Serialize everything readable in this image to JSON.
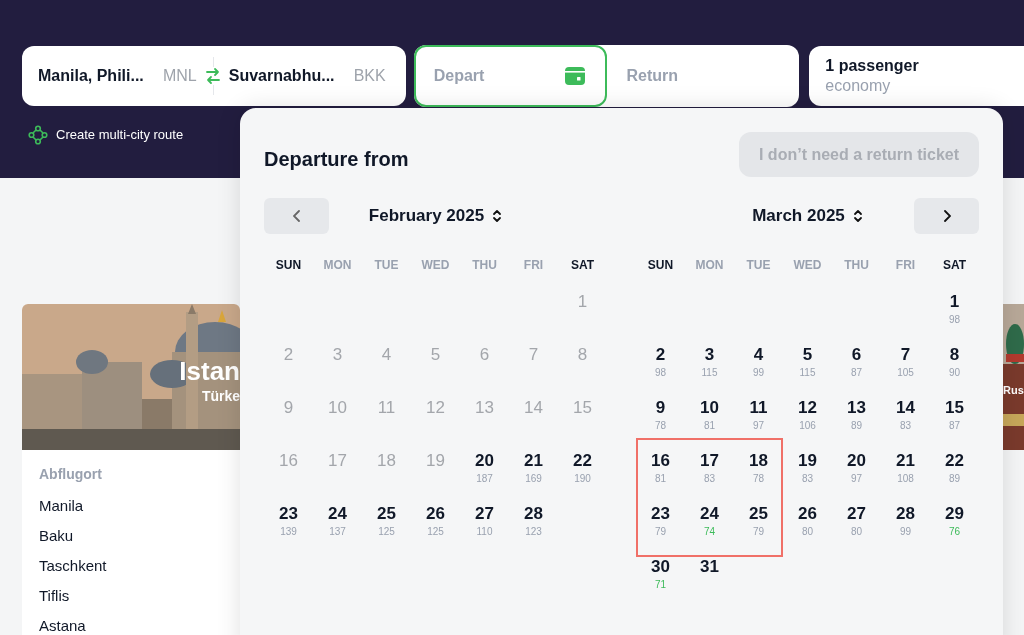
{
  "search": {
    "origin": {
      "city": "Manila, Phili...",
      "code": "MNL"
    },
    "destination": {
      "city": "Suvarnabhu...",
      "code": "BKK"
    },
    "dates": [
      {
        "placeholder": "Depart",
        "selected": true
      },
      {
        "placeholder": "Return",
        "selected": false
      }
    ],
    "passengers": {
      "count": "1 passenger",
      "cabin": "economy"
    },
    "multi_city_link": "Create multi-city route"
  },
  "destination_cards": [
    {
      "title": "Istan",
      "subtitle": "Türke",
      "list_heading": "Abflugort",
      "departures": [
        "Manila",
        "Baku",
        "Taschkent",
        "Tiflis",
        "Astana"
      ]
    },
    {
      "title": "Rus"
    }
  ],
  "date_picker": {
    "title": "Departure from",
    "no_return_button": "I don’t need a return ticket",
    "months": [
      {
        "name": "February 2025",
        "weekdays": [
          "SUN",
          "MON",
          "TUE",
          "WED",
          "THU",
          "FRI",
          "SAT"
        ],
        "weeks": [
          [
            {
              "kind": "blank"
            },
            {
              "kind": "blank"
            },
            {
              "kind": "blank"
            },
            {
              "kind": "blank"
            },
            {
              "kind": "blank"
            },
            {
              "kind": "blank"
            },
            {
              "kind": "day",
              "day": "1",
              "disabled": true
            }
          ],
          [
            {
              "kind": "day",
              "day": "2",
              "disabled": true
            },
            {
              "kind": "day",
              "day": "3",
              "disabled": true
            },
            {
              "kind": "day",
              "day": "4",
              "disabled": true
            },
            {
              "kind": "day",
              "day": "5",
              "disabled": true
            },
            {
              "kind": "day",
              "day": "6",
              "disabled": true
            },
            {
              "kind": "day",
              "day": "7",
              "disabled": true
            },
            {
              "kind": "day",
              "day": "8",
              "disabled": true
            }
          ],
          [
            {
              "kind": "day",
              "day": "9",
              "disabled": true
            },
            {
              "kind": "day",
              "day": "10",
              "disabled": true
            },
            {
              "kind": "day",
              "day": "11",
              "disabled": true
            },
            {
              "kind": "day",
              "day": "12",
              "disabled": true
            },
            {
              "kind": "day",
              "day": "13",
              "disabled": true
            },
            {
              "kind": "day",
              "day": "14",
              "disabled": true
            },
            {
              "kind": "day",
              "day": "15",
              "disabled": true
            }
          ],
          [
            {
              "kind": "day",
              "day": "16",
              "disabled": true
            },
            {
              "kind": "day",
              "day": "17",
              "disabled": true
            },
            {
              "kind": "day",
              "day": "18",
              "disabled": true
            },
            {
              "kind": "day",
              "day": "19",
              "disabled": true
            },
            {
              "kind": "day",
              "day": "20",
              "price": "187"
            },
            {
              "kind": "day",
              "day": "21",
              "price": "169"
            },
            {
              "kind": "day",
              "day": "22",
              "price": "190"
            }
          ],
          [
            {
              "kind": "day",
              "day": "23",
              "price": "139"
            },
            {
              "kind": "day",
              "day": "24",
              "price": "137"
            },
            {
              "kind": "day",
              "day": "25",
              "price": "125"
            },
            {
              "kind": "day",
              "day": "26",
              "price": "125"
            },
            {
              "kind": "day",
              "day": "27",
              "price": "110"
            },
            {
              "kind": "day",
              "day": "28",
              "price": "123"
            },
            {
              "kind": "blank"
            }
          ]
        ]
      },
      {
        "name": "March 2025",
        "weekdays": [
          "SUN",
          "MON",
          "TUE",
          "WED",
          "THU",
          "FRI",
          "SAT"
        ],
        "weeks": [
          [
            {
              "kind": "blank"
            },
            {
              "kind": "blank"
            },
            {
              "kind": "blank"
            },
            {
              "kind": "blank"
            },
            {
              "kind": "blank"
            },
            {
              "kind": "blank"
            },
            {
              "kind": "day",
              "day": "1",
              "price": "98"
            }
          ],
          [
            {
              "kind": "day",
              "day": "2",
              "price": "98"
            },
            {
              "kind": "day",
              "day": "3",
              "price": "115"
            },
            {
              "kind": "day",
              "day": "4",
              "price": "99"
            },
            {
              "kind": "day",
              "day": "5",
              "price": "115"
            },
            {
              "kind": "day",
              "day": "6",
              "price": "87"
            },
            {
              "kind": "day",
              "day": "7",
              "price": "105"
            },
            {
              "kind": "day",
              "day": "8",
              "price": "90"
            }
          ],
          [
            {
              "kind": "day",
              "day": "9",
              "price": "78"
            },
            {
              "kind": "day",
              "day": "10",
              "price": "81"
            },
            {
              "kind": "day",
              "day": "11",
              "price": "97"
            },
            {
              "kind": "day",
              "day": "12",
              "price": "106"
            },
            {
              "kind": "day",
              "day": "13",
              "price": "89"
            },
            {
              "kind": "day",
              "day": "14",
              "price": "83"
            },
            {
              "kind": "day",
              "day": "15",
              "price": "87"
            }
          ],
          [
            {
              "kind": "day",
              "day": "16",
              "price": "81",
              "marked": true
            },
            {
              "kind": "day",
              "day": "17",
              "price": "83",
              "marked": true
            },
            {
              "kind": "day",
              "day": "18",
              "price": "78",
              "marked": true
            },
            {
              "kind": "day",
              "day": "19",
              "price": "83"
            },
            {
              "kind": "day",
              "day": "20",
              "price": "97"
            },
            {
              "kind": "day",
              "day": "21",
              "price": "108"
            },
            {
              "kind": "day",
              "day": "22",
              "price": "89"
            }
          ],
          [
            {
              "kind": "day",
              "day": "23",
              "price": "79",
              "marked": true
            },
            {
              "kind": "day",
              "day": "24",
              "price": "74",
              "cheap": true,
              "marked": true
            },
            {
              "kind": "day",
              "day": "25",
              "price": "79",
              "marked": true
            },
            {
              "kind": "day",
              "day": "26",
              "price": "80"
            },
            {
              "kind": "day",
              "day": "27",
              "price": "80"
            },
            {
              "kind": "day",
              "day": "28",
              "price": "99"
            },
            {
              "kind": "day",
              "day": "29",
              "price": "76",
              "cheap": true
            }
          ],
          [
            {
              "kind": "day",
              "day": "30",
              "price": "71",
              "cheap": true
            },
            {
              "kind": "day",
              "day": "31"
            },
            {
              "kind": "blank"
            },
            {
              "kind": "blank"
            },
            {
              "kind": "blank"
            },
            {
              "kind": "blank"
            },
            {
              "kind": "blank"
            }
          ]
        ]
      }
    ]
  }
}
